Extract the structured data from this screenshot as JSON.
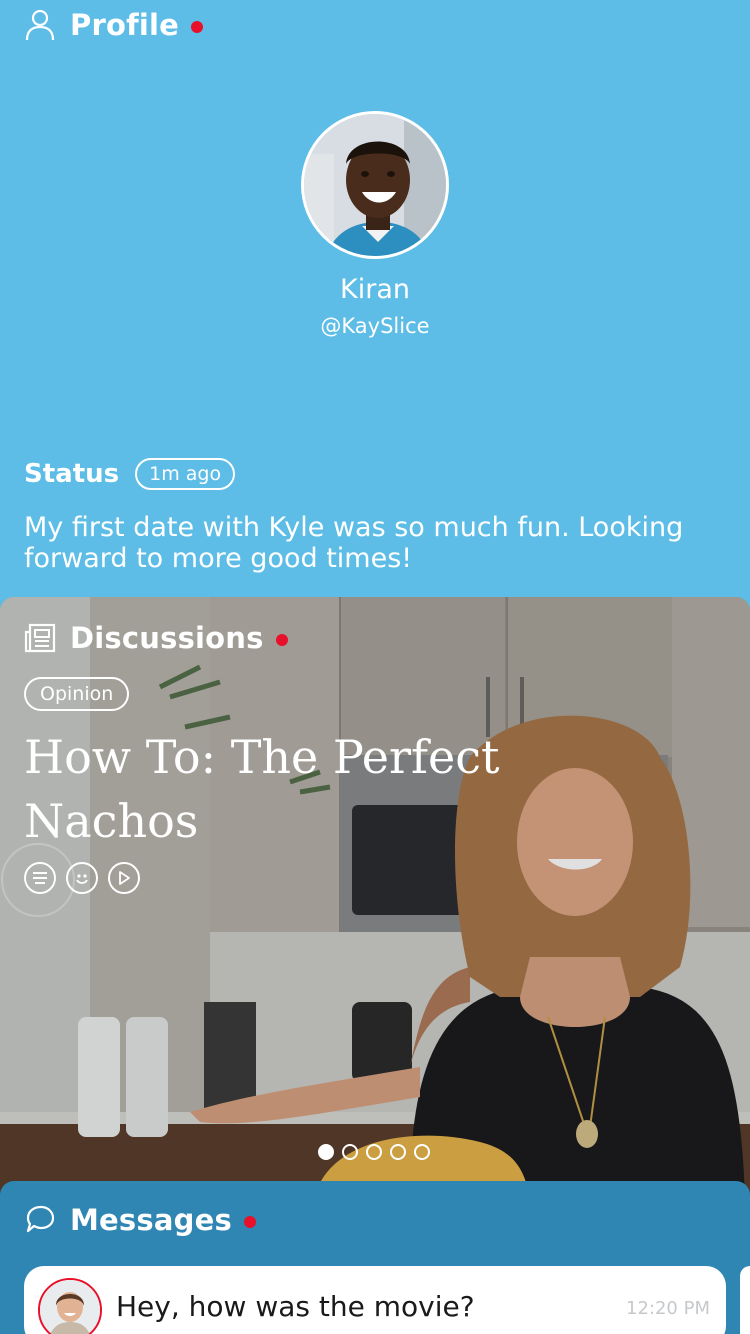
{
  "profile": {
    "section_title": "Profile",
    "name": "Kiran",
    "handle": "@KaySlice",
    "status_label": "Status",
    "status_time": "1m ago",
    "status_text": "My first date with Kyle was so much fun.  Looking forward to more good times!"
  },
  "discussions": {
    "section_title": "Discussions",
    "tag": "Opinion",
    "article_title": "How To: The Perfect Nachos",
    "pager": {
      "total": 5,
      "active_index": 0
    }
  },
  "messages": {
    "section_title": "Messages",
    "items": [
      {
        "text": "Hey, how was the movie?",
        "time": "12:20 PM"
      }
    ]
  },
  "colors": {
    "profile_bg": "#5dbde6",
    "messages_bg": "#2f86b2",
    "notification_dot": "#e8102a"
  },
  "icons": [
    "person-icon",
    "newspaper-icon",
    "chat-bubble-icon",
    "list-icon",
    "smiley-icon",
    "play-icon"
  ]
}
